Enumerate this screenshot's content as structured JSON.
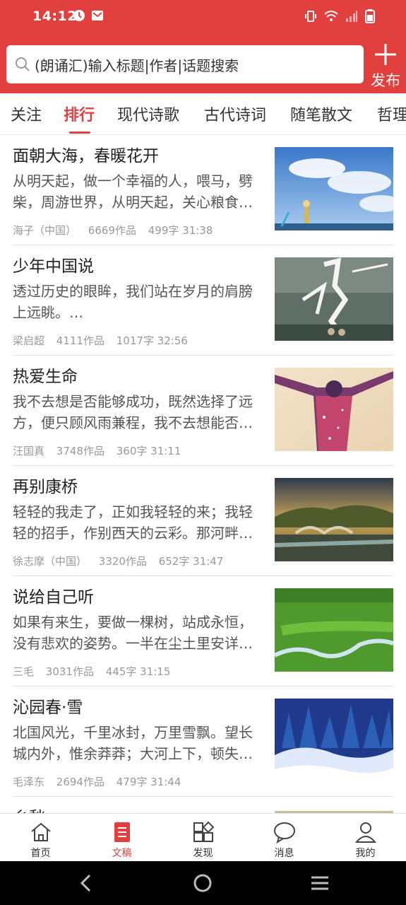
{
  "status_bar": {
    "time": "14:12"
  },
  "search": {
    "placeholder": "(朗诵汇)输入标题|作者|话题搜索"
  },
  "header": {
    "publish_label": "发布",
    "accent_color": "#e2403f"
  },
  "tabs": [
    {
      "label": "关注",
      "active": false
    },
    {
      "label": "排行",
      "active": true
    },
    {
      "label": "现代诗歌",
      "active": false
    },
    {
      "label": "古代诗词",
      "active": false
    },
    {
      "label": "随笔散文",
      "active": false
    },
    {
      "label": "哲理",
      "active": false
    }
  ],
  "articles": [
    {
      "title": "面朝大海，春暖花开",
      "summary": "从明天起，做一个幸福的人，喂马，劈柴，周游世界，从明天起，关心粮食…",
      "author": "海子（中国）",
      "works": "6669作品",
      "stats": "499字 31:38",
      "thumb": "sea-sky"
    },
    {
      "title": "少年中国说",
      "summary": "透过历史的眼眸，我们站在岁月的肩膀上远眺。…",
      "author": "梁启超",
      "works": "4111作品",
      "stats": "1017字 32:56",
      "thumb": "calligraphy"
    },
    {
      "title": "热爱生命",
      "summary": "我不去想是否能够成功，既然选择了远方，便只顾风雨兼程，我不去想能否…",
      "author": "汪国真",
      "works": "3748作品",
      "stats": "360字 31:11",
      "thumb": "galaxy-figure"
    },
    {
      "title": "再别康桥",
      "summary": "轻轻的我走了，正如我轻轻的来；我轻轻的招手，作别西天的云彩。那河畔…",
      "author": "徐志摩（中国）",
      "works": "3320作品",
      "stats": "652字 31:47",
      "thumb": "bridge-river"
    },
    {
      "title": "说给自己听",
      "summary": "如果有来生，要做一棵树，站成永恒，没有悲欢的姿势。一半在尘土里安详…",
      "author": "三毛",
      "works": "3031作品",
      "stats": "445字 31:15",
      "thumb": "grassland"
    },
    {
      "title": "沁园春·雪",
      "summary": "北国风光，千里冰封，万里雪飘。望长城内外，惟余莽莽；大河上下，顿失…",
      "author": "毛泽东",
      "works": "2694作品",
      "stats": "479字 31:44",
      "thumb": "snow-forest"
    },
    {
      "title": "乡愁",
      "summary": "",
      "author": "",
      "works": "",
      "stats": "",
      "thumb": "partial"
    }
  ],
  "bottom_nav": [
    {
      "label": "首页",
      "icon": "home-icon",
      "active": false
    },
    {
      "label": "文稿",
      "icon": "document-icon",
      "active": true
    },
    {
      "label": "发现",
      "icon": "discover-icon",
      "active": false
    },
    {
      "label": "消息",
      "icon": "message-icon",
      "active": false
    },
    {
      "label": "我的",
      "icon": "profile-icon",
      "active": false
    }
  ]
}
